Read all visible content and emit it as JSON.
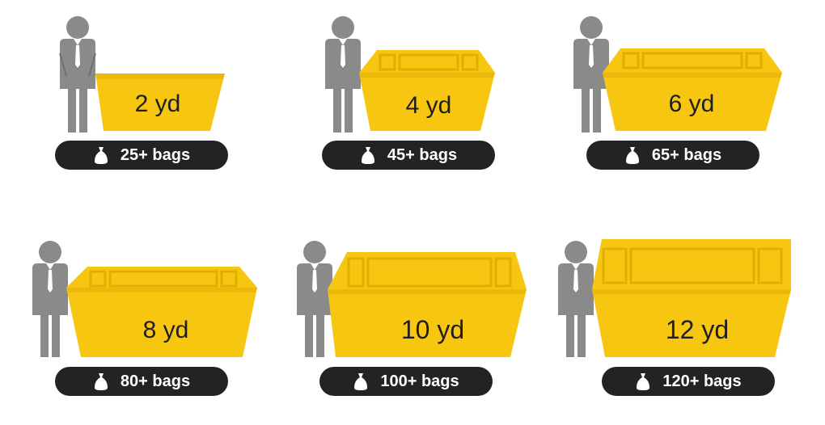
{
  "colors": {
    "skip_fill": "#F7C611",
    "skip_edge": "#E0AE00",
    "person": "#8A8A8A",
    "pill_bg": "#232323",
    "pill_text": "#FFFFFF",
    "label_text": "#1E1E1E"
  },
  "icons": {
    "person": "person-silhouette-icon",
    "bag": "rubbish-bag-icon"
  },
  "skips": [
    {
      "size": "2 yd",
      "bags": "25+ bags"
    },
    {
      "size": "4 yd",
      "bags": "45+ bags"
    },
    {
      "size": "6 yd",
      "bags": "65+ bags"
    },
    {
      "size": "8 yd",
      "bags": "80+ bags"
    },
    {
      "size": "10 yd",
      "bags": "100+ bags"
    },
    {
      "size": "12 yd",
      "bags": "120+ bags"
    }
  ]
}
